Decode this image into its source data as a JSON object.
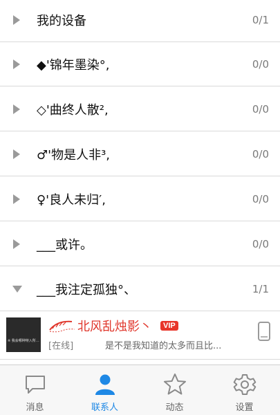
{
  "groups": [
    {
      "name": "我的设备",
      "count": "0/1",
      "expanded": false
    },
    {
      "name": "◆'锦年墨染°,",
      "count": "0/0",
      "expanded": false
    },
    {
      "name": "◇'曲终人散²,",
      "count": "0/0",
      "expanded": false
    },
    {
      "name": "♂'物是人非³,",
      "count": "0/0",
      "expanded": false
    },
    {
      "name": "♀'良人未归′,",
      "count": "0/0",
      "expanded": false
    },
    {
      "name": "___或许。",
      "count": "0/0",
      "expanded": false
    },
    {
      "name": "___我注定孤独°、",
      "count": "1/1",
      "expanded": true
    }
  ],
  "contact": {
    "name": "北风乱烛影丶",
    "badge": "VIP",
    "status": "[在线]",
    "signature": "是不是我知道的太多而且比...",
    "avatar_text": "※ 我会哪种特入所…",
    "name_color": "#e0372c",
    "badge_color": "#e8352a",
    "icons": {
      "decoration": "feather-pen-icon",
      "device": "phone-icon"
    }
  },
  "tabs": [
    {
      "label": "消息",
      "icon": "message-bubble-icon",
      "active": false
    },
    {
      "label": "联系人",
      "icon": "contact-person-icon",
      "active": true
    },
    {
      "label": "动态",
      "icon": "star-icon",
      "active": false
    },
    {
      "label": "设置",
      "icon": "gear-icon",
      "active": false
    }
  ],
  "colors": {
    "accent": "#1e88e5",
    "inactive_icon": "#8a8a8a",
    "chevron": "#9a9a9a",
    "divider": "#d9d9d9"
  }
}
